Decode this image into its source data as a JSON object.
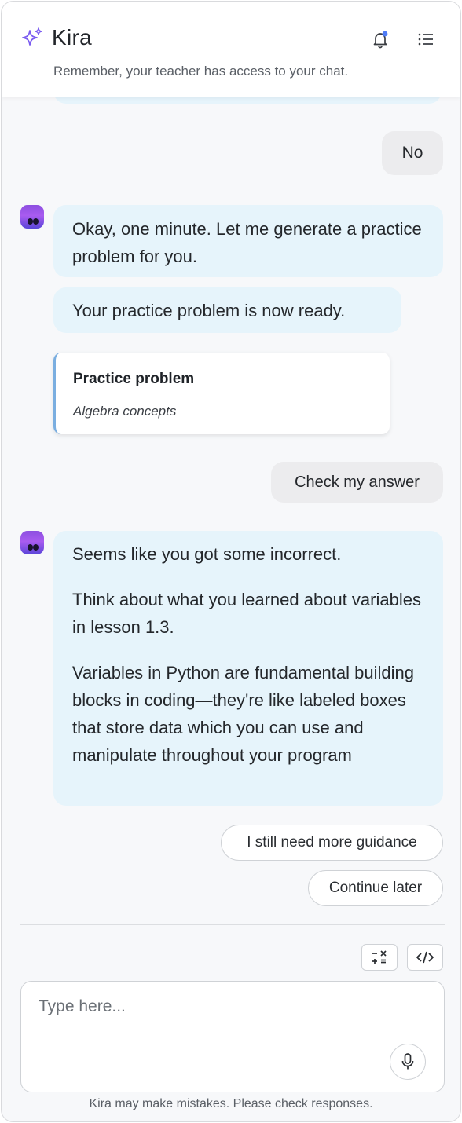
{
  "header": {
    "title": "Kira",
    "subtitle": "Remember, your teacher has access to your chat.",
    "icons": {
      "brand": "sparkle-icon",
      "notifications": "bell-icon",
      "menu": "list-menu-icon"
    },
    "notification_dot_color": "#4f7cf7"
  },
  "messages": {
    "user_no": "No",
    "bot_generate": "Okay, one minute. Let me generate a practice problem for you.",
    "bot_ready": "Your practice problem is now ready.",
    "card": {
      "title": "Practice problem",
      "subtitle": "Algebra concepts"
    },
    "user_check": "Check my answer",
    "bot_feedback": {
      "p1": "Seems like you got some incorrect.",
      "p2": "Think about what you learned about variables in lesson 1.3.",
      "p3": "Variables in Python are fundamental building blocks in coding—they're like labeled boxes that store data which you can use and manipulate throughout your program"
    }
  },
  "suggestions": {
    "more_guidance": "I still need more guidance",
    "continue_later": "Continue later"
  },
  "composer": {
    "placeholder": "Type here...",
    "tools": {
      "calculator": "calculator-icon",
      "code": "code-icon"
    },
    "mic": "microphone-icon"
  },
  "footer": {
    "disclaimer": "Kira may make mistakes. Please check responses."
  },
  "colors": {
    "bot_bubble": "#e6f4fb",
    "user_bubble": "#ececee",
    "accent": "#7b5cf0"
  }
}
